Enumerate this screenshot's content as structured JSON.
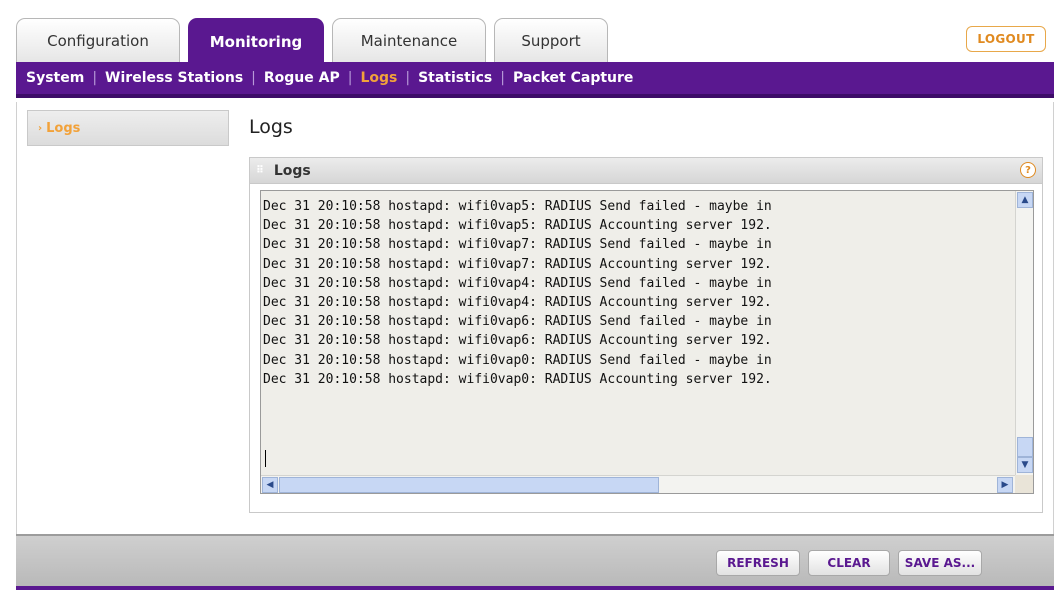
{
  "tabs": [
    {
      "label": "Configuration"
    },
    {
      "label": "Monitoring"
    },
    {
      "label": "Maintenance"
    },
    {
      "label": "Support"
    }
  ],
  "logout_label": "LOGOUT",
  "subnav": [
    {
      "label": "System"
    },
    {
      "label": "Wireless Stations"
    },
    {
      "label": "Rogue AP"
    },
    {
      "label": "Logs"
    },
    {
      "label": "Statistics"
    },
    {
      "label": "Packet Capture"
    }
  ],
  "sidebar": {
    "items": [
      {
        "label": "Logs"
      }
    ]
  },
  "page_title": "Logs",
  "panel": {
    "title": "Logs",
    "help_icon": "?"
  },
  "log_lines": [
    "Dec 31 20:10:58 hostapd: wifi0vap5: RADIUS Send failed - maybe in",
    "Dec 31 20:10:58 hostapd: wifi0vap5: RADIUS Accounting server 192.",
    "Dec 31 20:10:58 hostapd: wifi0vap7: RADIUS Send failed - maybe in",
    "Dec 31 20:10:58 hostapd: wifi0vap7: RADIUS Accounting server 192.",
    "Dec 31 20:10:58 hostapd: wifi0vap4: RADIUS Send failed - maybe in",
    "Dec 31 20:10:58 hostapd: wifi0vap4: RADIUS Accounting server 192.",
    "Dec 31 20:10:58 hostapd: wifi0vap6: RADIUS Send failed - maybe in",
    "Dec 31 20:10:58 hostapd: wifi0vap6: RADIUS Accounting server 192.",
    "Dec 31 20:10:58 hostapd: wifi0vap0: RADIUS Send failed - maybe in",
    "Dec 31 20:10:58 hostapd: wifi0vap0: RADIUS Accounting server 192."
  ],
  "footer": {
    "refresh": "REFRESH",
    "clear": "CLEAR",
    "save_as": "SAVE AS..."
  },
  "colors": {
    "brand": "#5a1890",
    "accent": "#f2a23a"
  }
}
